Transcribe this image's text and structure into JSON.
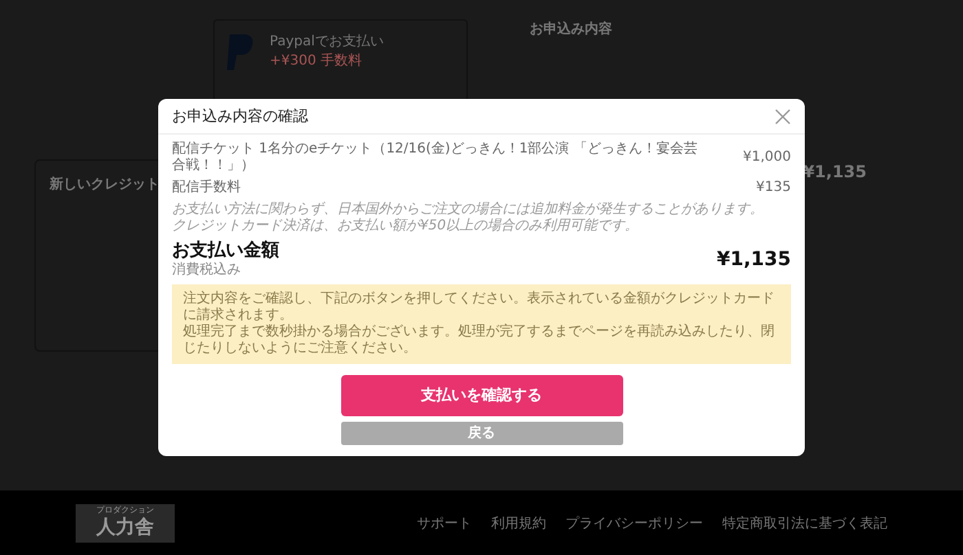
{
  "page": {
    "paypal": {
      "title": "Paypalでお支払い",
      "fee": "+¥300 手数料"
    },
    "credit_card": {
      "title": "新しいクレジット"
    },
    "summary": {
      "title": "お申込み内容",
      "total": "¥1,135"
    }
  },
  "footer": {
    "logo": {
      "small": "プロダクション",
      "main": "人力舎"
    },
    "links": [
      "サポート",
      "利用規約",
      "プライバシーポリシー",
      "特定商取引法に基づく表記"
    ]
  },
  "dialog": {
    "title": "お申込み内容の確認",
    "items": [
      {
        "name": "配信チケット 1名分のeチケット（12/16(金)どっきん！1部公演 「どっきん！宴会芸合戦！！」）",
        "price": "¥1,000"
      },
      {
        "name": "配信手数料",
        "price": "¥135"
      }
    ],
    "notes": [
      "お支払い方法に関わらず、日本国外からご注文の場合には追加料金が発生することがあります。",
      "クレジットカード決済は、お支払い額が¥50以上の場合のみ利用可能です。"
    ],
    "total": {
      "label": "お支払い金額",
      "sublabel": "消費税込み",
      "amount": "¥1,135"
    },
    "notice": [
      "注文内容をご確認し、下記のボタンを押してください。表示されている金額がクレジットカードに請求されます。",
      "処理完了まで数秒掛かる場合がございます。処理が完了するまでページを再読み込みしたり、閉じたりしないようにご注意ください。"
    ],
    "buttons": {
      "confirm": "支払いを確認する",
      "back": "戻る"
    }
  }
}
